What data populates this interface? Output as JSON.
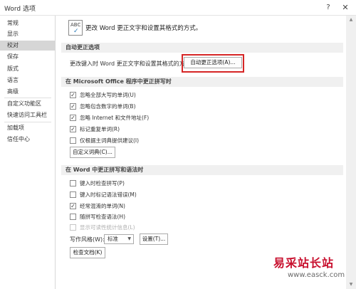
{
  "window": {
    "title": "Word 选项",
    "help_label": "?",
    "close_label": "✕"
  },
  "sidebar": {
    "items": [
      {
        "label": "常规"
      },
      {
        "label": "显示"
      },
      {
        "label": "校对"
      },
      {
        "label": "保存"
      },
      {
        "label": "版式"
      },
      {
        "label": "语言"
      },
      {
        "label": "高级"
      },
      {
        "label": "自定义功能区"
      },
      {
        "label": "快速访问工具栏"
      },
      {
        "label": "加载项"
      },
      {
        "label": "信任中心"
      }
    ],
    "active_index": 2
  },
  "main": {
    "header_icon_text": "ABC",
    "header_text": "更改 Word 更正文字和设置其格式的方式。",
    "autocorrect": {
      "section_title": "自动更正选项",
      "description": "更改键入时 Word 更正文字和设置其格式的方式：",
      "button_label": "自动更正选项(A)..."
    },
    "office_spelling": {
      "section_title": "在 Microsoft Office 程序中更正拼写时",
      "options": [
        {
          "label": "忽略全部大写的单词(U)",
          "checked": true
        },
        {
          "label": "忽略包含数字的单词(B)",
          "checked": true
        },
        {
          "label": "忽略 Internet 和文件地址(F)",
          "checked": true
        },
        {
          "label": "标记重复单词(R)",
          "checked": true
        },
        {
          "label": "仅根据主词典提供建议(I)",
          "checked": false
        }
      ],
      "custom_dict_button": "自定义词典(C)..."
    },
    "word_spelling": {
      "section_title": "在 Word 中更正拼写和语法时",
      "options": [
        {
          "label": "键入时检查拼写(P)",
          "checked": false,
          "disabled": false
        },
        {
          "label": "键入时标记语法错误(M)",
          "checked": false,
          "disabled": false
        },
        {
          "label": "经常混淆的单词(N)",
          "checked": true,
          "disabled": false
        },
        {
          "label": "随拼写检查语法(H)",
          "checked": false,
          "disabled": false
        },
        {
          "label": "显示可读性统计信息(L)",
          "checked": false,
          "disabled": true
        }
      ],
      "writing_style_label": "写作风格(W):",
      "writing_style_value": "标准",
      "settings_button": "设置(T)...",
      "check_document_button": "检查文档(K)"
    }
  },
  "watermark": {
    "main": "易采站长站",
    "url": "www.easck.com"
  },
  "colors": {
    "highlight": "#d62626",
    "watermark": "#c8102e"
  }
}
